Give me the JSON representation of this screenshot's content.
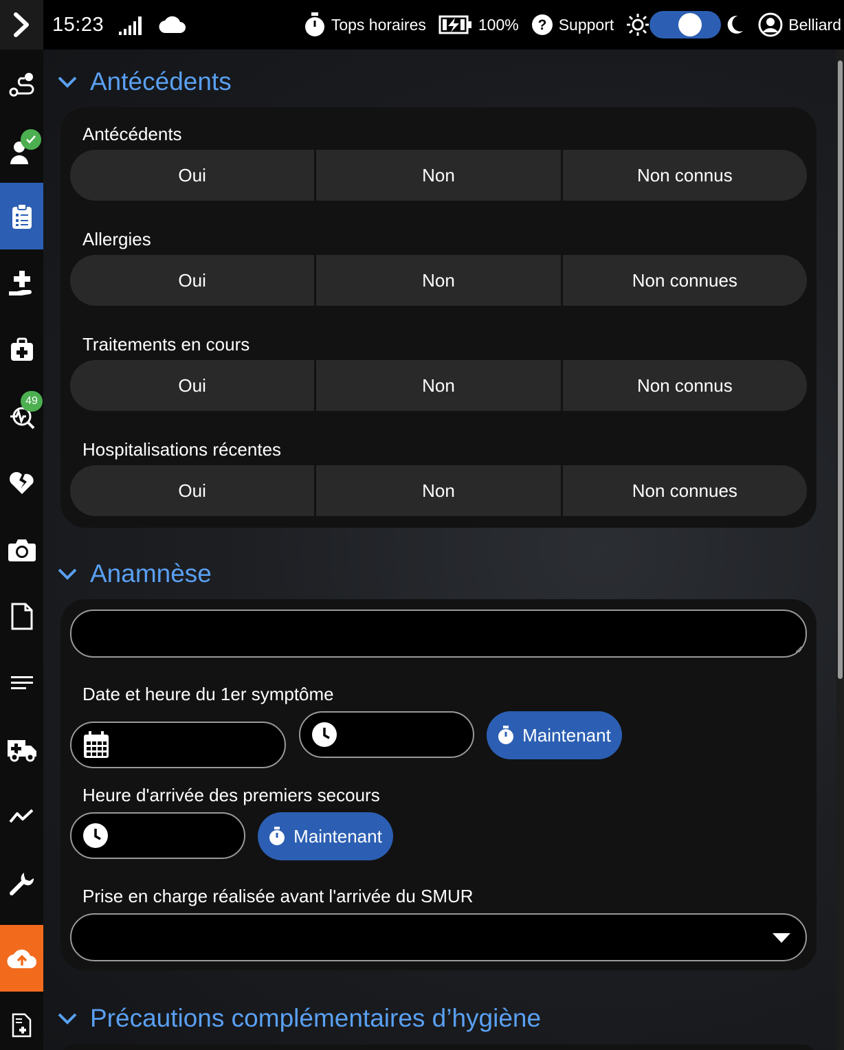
{
  "status_bar": {
    "time": "15:23",
    "tops_label": "Tops horaires",
    "battery": "100%",
    "support_label": "Support",
    "user_name": "Belliard"
  },
  "sidebar": {
    "badges": {
      "monitoring": "49"
    }
  },
  "sections": {
    "antecedents": {
      "title": "Antécédents",
      "fields": [
        {
          "label": "Antécédents",
          "options": [
            "Oui",
            "Non",
            "Non connus"
          ]
        },
        {
          "label": "Allergies",
          "options": [
            "Oui",
            "Non",
            "Non connues"
          ]
        },
        {
          "label": "Traitements en cours",
          "options": [
            "Oui",
            "Non",
            "Non connus"
          ]
        },
        {
          "label": "Hospitalisations récentes",
          "options": [
            "Oui",
            "Non",
            "Non connues"
          ]
        }
      ]
    },
    "anamnese": {
      "title": "Anamnèse",
      "first_symptom_label": "Date et heure du 1er symptôme",
      "first_aid_label": "Heure d'arrivée des premiers secours",
      "now_label": "Maintenant",
      "prise_label": "Prise en charge réalisée avant l'arrivée du SMUR"
    },
    "hygiene": {
      "title": "Précautions complémentaires d’hygiène"
    }
  },
  "colors": {
    "accent": "#2c5fb3",
    "title": "#5aa0f2",
    "upload": "#f26b1d",
    "badge": "#4caf50"
  }
}
